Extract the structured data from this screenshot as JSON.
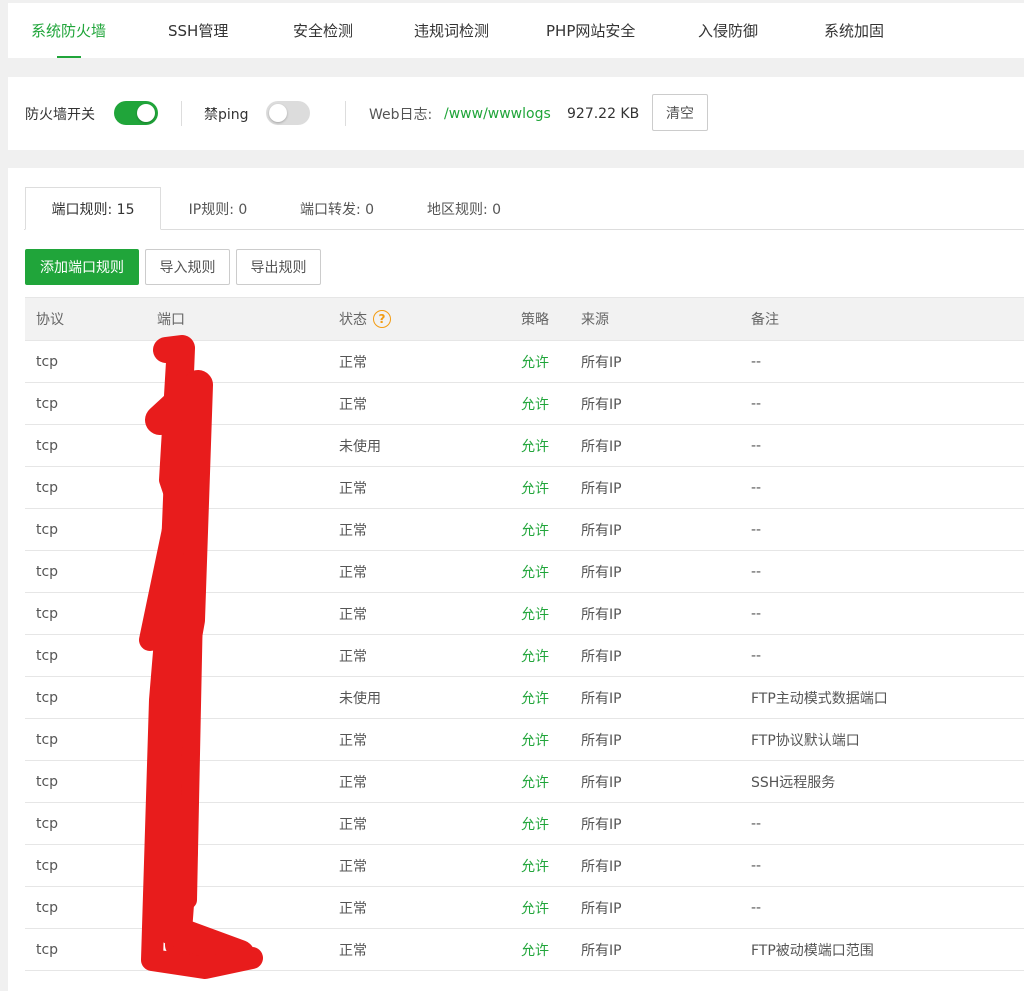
{
  "top_tabs": [
    {
      "label": "系统防火墙",
      "active": true
    },
    {
      "label": "SSH管理"
    },
    {
      "label": "安全检测"
    },
    {
      "label": "违规词检测"
    },
    {
      "label": "PHP网站安全"
    },
    {
      "label": "入侵防御"
    },
    {
      "label": "系统加固"
    }
  ],
  "settings": {
    "firewall_label": "防火墙开关",
    "firewall_on": true,
    "ping_label": "禁ping",
    "ping_on": false,
    "weblog_label": "Web日志:",
    "weblog_path": "/www/wwwlogs",
    "weblog_size": "927.22 KB",
    "clear_label": "清空"
  },
  "sub_tabs": [
    {
      "label": "端口规则: 15",
      "active": true
    },
    {
      "label": "IP规则: 0"
    },
    {
      "label": "端口转发: 0"
    },
    {
      "label": "地区规则: 0"
    }
  ],
  "actions": {
    "add": "添加端口规则",
    "import": "导入规则",
    "export": "导出规则"
  },
  "table": {
    "headers": {
      "proto": "协议",
      "port": "端口",
      "status": "状态",
      "policy": "策略",
      "source": "来源",
      "note": "备注"
    },
    "help_icon": "question-circle-icon",
    "rows": [
      {
        "proto": "tcp",
        "status": "正常",
        "policy": "允许",
        "source": "所有IP",
        "note": "--"
      },
      {
        "proto": "tcp",
        "status": "正常",
        "policy": "允许",
        "source": "所有IP",
        "note": "--"
      },
      {
        "proto": "tcp",
        "status": "未使用",
        "policy": "允许",
        "source": "所有IP",
        "note": "--"
      },
      {
        "proto": "tcp",
        "status": "正常",
        "policy": "允许",
        "source": "所有IP",
        "note": "--"
      },
      {
        "proto": "tcp",
        "status": "正常",
        "policy": "允许",
        "source": "所有IP",
        "note": "--"
      },
      {
        "proto": "tcp",
        "status": "正常",
        "policy": "允许",
        "source": "所有IP",
        "note": "--"
      },
      {
        "proto": "tcp",
        "status": "正常",
        "policy": "允许",
        "source": "所有IP",
        "note": "--"
      },
      {
        "proto": "tcp",
        "status": "正常",
        "policy": "允许",
        "source": "所有IP",
        "note": "--"
      },
      {
        "proto": "tcp",
        "status": "未使用",
        "policy": "允许",
        "source": "所有IP",
        "note": "FTP主动模式数据端口"
      },
      {
        "proto": "tcp",
        "status": "正常",
        "policy": "允许",
        "source": "所有IP",
        "note": "FTP协议默认端口"
      },
      {
        "proto": "tcp",
        "status": "正常",
        "policy": "允许",
        "source": "所有IP",
        "note": "SSH远程服务"
      },
      {
        "proto": "tcp",
        "status": "正常",
        "policy": "允许",
        "source": "所有IP",
        "note": "--"
      },
      {
        "proto": "tcp",
        "status": "正常",
        "policy": "允许",
        "source": "所有IP",
        "note": "--"
      },
      {
        "proto": "tcp",
        "status": "正常",
        "policy": "允许",
        "source": "所有IP",
        "note": "--"
      },
      {
        "proto": "tcp",
        "status": "正常",
        "policy": "允许",
        "source": "所有IP",
        "note": "FTP被动模端口范围"
      }
    ]
  },
  "colors": {
    "accent": "#20a53a",
    "redaction": "#e81c1c",
    "help": "#f39c12"
  }
}
